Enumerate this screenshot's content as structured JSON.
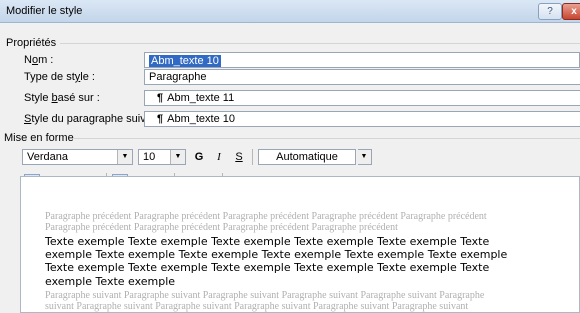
{
  "window": {
    "title": "Modifier le style",
    "help_label": "?",
    "close_label": "x"
  },
  "properties": {
    "section_label": "Propriétés",
    "nom_label_pre": "N",
    "nom_label_u": "o",
    "nom_label_post": "m :",
    "nom_value": "Abm_texte 10",
    "type_label_pre": "Type de st",
    "type_label_u": "y",
    "type_label_post": "le :",
    "type_value": "Paragraphe",
    "base_label_pre": "Style ",
    "base_label_u": "b",
    "base_label_post": "asé sur :",
    "base_value": "Abm_texte 11",
    "next_label_pre": "",
    "next_label_u": "S",
    "next_label_post": "tyle du paragraphe suivant :",
    "next_value": "Abm_texte 10",
    "pilcrow": "¶"
  },
  "formatting": {
    "section_label": "Mise en forme",
    "font": "Verdana",
    "size": "10",
    "bold": "G",
    "italic": "I",
    "underline": "S",
    "color": "Automatique"
  },
  "preview": {
    "prev_line1": "Paragraphe précédent Paragraphe précédent Paragraphe précédent Paragraphe précédent Paragraphe précédent",
    "prev_line2": "Paragraphe précédent Paragraphe précédent Paragraphe précédent Paragraphe précédent",
    "sample_line1": "Texte exemple Texte exemple Texte exemple Texte exemple Texte exemple Texte",
    "sample_line2": "exemple Texte exemple Texte exemple Texte exemple Texte exemple Texte exemple",
    "sample_line3": "Texte exemple Texte exemple Texte exemple Texte exemple Texte exemple Texte",
    "sample_line4": "exemple Texte exemple",
    "next_line1": "Paragraphe suivant Paragraphe suivant Paragraphe suivant Paragraphe suivant Paragraphe suivant Paragraphe",
    "next_line2": "suivant Paragraphe suivant Paragraphe suivant Paragraphe suivant Paragraphe suivant Paragraphe suivant"
  }
}
